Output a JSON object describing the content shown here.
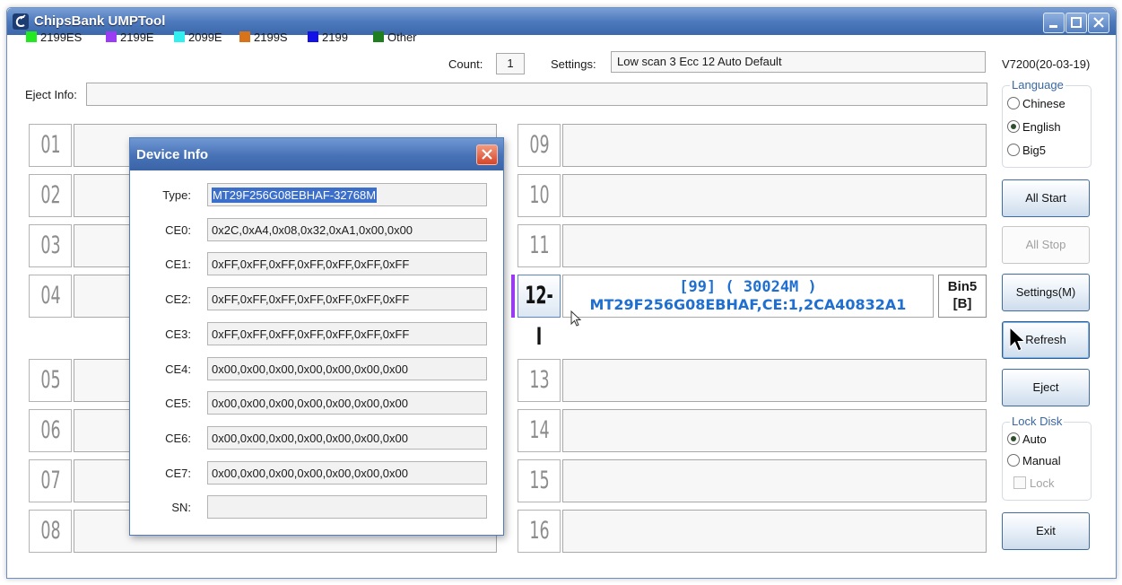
{
  "window": {
    "title": "ChipsBank UMPTool"
  },
  "legend": [
    {
      "label": "2199ES",
      "color": "#22e822"
    },
    {
      "label": "2199E",
      "color": "#9b3cf5"
    },
    {
      "label": "2099E",
      "color": "#33f0f0"
    },
    {
      "label": "2199S",
      "color": "#d9731a"
    },
    {
      "label": "2199",
      "color": "#1212e8"
    },
    {
      "label": "Other",
      "color": "#1f7e1f"
    }
  ],
  "count": {
    "label": "Count:",
    "value": "1"
  },
  "settings": {
    "label": "Settings:",
    "value": "Low scan 3 Ecc 12 Auto Default"
  },
  "version": "V7200(20-03-19)",
  "eject_info": {
    "label": "Eject Info:",
    "value": ""
  },
  "slots_left": [
    "01",
    "02",
    "03",
    "04",
    "05",
    "06",
    "07",
    "08"
  ],
  "slots_right": [
    "09",
    "10",
    "11",
    "12-I",
    "13",
    "14",
    "15",
    "16"
  ],
  "active_slot": {
    "number": "12-I",
    "line1": "[99]  ( 30024M )",
    "line2": "MT29F256G08EBHAF,CE:1,2CA40832A1",
    "bin": "Bin5",
    "bin2": "[B]",
    "color": "#1f6fd1"
  },
  "language": {
    "title": "Language",
    "options": [
      {
        "label": "Chinese",
        "selected": false
      },
      {
        "label": "English",
        "selected": true
      },
      {
        "label": "Big5",
        "selected": false
      }
    ]
  },
  "buttons": {
    "all_start": "All Start",
    "all_stop": "All Stop",
    "settings": "Settings(M)",
    "refresh": "Refresh",
    "eject": "Eject",
    "exit": "Exit"
  },
  "lock_disk": {
    "title": "Lock Disk",
    "options": [
      {
        "label": "Auto",
        "selected": true
      },
      {
        "label": "Manual",
        "selected": false
      }
    ],
    "lock_label": "Lock"
  },
  "device_info": {
    "title": "Device Info",
    "rows": [
      {
        "label": "Type:",
        "value": "MT29F256G08EBHAF-32768M"
      },
      {
        "label": "CE0:",
        "value": "0x2C,0xA4,0x08,0x32,0xA1,0x00,0x00"
      },
      {
        "label": "CE1:",
        "value": "0xFF,0xFF,0xFF,0xFF,0xFF,0xFF,0xFF"
      },
      {
        "label": "CE2:",
        "value": "0xFF,0xFF,0xFF,0xFF,0xFF,0xFF,0xFF"
      },
      {
        "label": "CE3:",
        "value": "0xFF,0xFF,0xFF,0xFF,0xFF,0xFF,0xFF"
      },
      {
        "label": "CE4:",
        "value": "0x00,0x00,0x00,0x00,0x00,0x00,0x00"
      },
      {
        "label": "CE5:",
        "value": "0x00,0x00,0x00,0x00,0x00,0x00,0x00"
      },
      {
        "label": "CE6:",
        "value": "0x00,0x00,0x00,0x00,0x00,0x00,0x00"
      },
      {
        "label": "CE7:",
        "value": "0x00,0x00,0x00,0x00,0x00,0x00,0x00"
      },
      {
        "label": "SN:",
        "value": ""
      }
    ]
  }
}
